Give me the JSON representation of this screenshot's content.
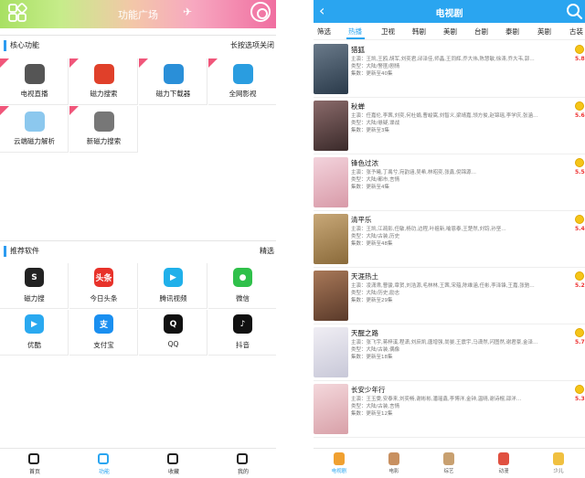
{
  "left": {
    "header_title": "功能广场",
    "core": {
      "label": "核心功能",
      "more": "长按选项关闭",
      "tiles": [
        {
          "name": "电视直播",
          "icon": "tv-icon",
          "color": "#555555"
        },
        {
          "name": "磁力搜索",
          "icon": "magnet-search-icon",
          "color": "#e0402a"
        },
        {
          "name": "磁力下载器",
          "icon": "magnet-download-icon",
          "color": "#2a8fd8"
        },
        {
          "name": "全网影视",
          "icon": "film-icon",
          "color": "#2a9de0"
        },
        {
          "name": "云端磁力解析",
          "icon": "cloud-icon",
          "color": "#8cc8ee"
        },
        {
          "name": "新磁力搜索",
          "icon": "search-magnifier-icon",
          "color": "#777777"
        }
      ]
    },
    "recommend": {
      "label": "推荐软件",
      "more": "精选",
      "apps": [
        {
          "name": "磁力搜",
          "icon": "magnet-s-icon",
          "glyph": "S",
          "color": "#222222"
        },
        {
          "name": "今日头条",
          "icon": "toutiao-icon",
          "glyph": "头条",
          "color": "#e8322a"
        },
        {
          "name": "腾讯视频",
          "icon": "tencent-video-icon",
          "glyph": "▶",
          "color": "#20b0ea"
        },
        {
          "name": "微信",
          "icon": "wechat-icon",
          "glyph": "●",
          "color": "#2fc04a"
        },
        {
          "name": "优酷",
          "icon": "youku-icon",
          "glyph": "▶",
          "color": "#2aa9f0"
        },
        {
          "name": "支付宝",
          "icon": "alipay-icon",
          "glyph": "支",
          "color": "#1a8ff0"
        },
        {
          "name": "QQ",
          "icon": "qq-icon",
          "glyph": "Q",
          "color": "#111111"
        },
        {
          "name": "抖音",
          "icon": "douyin-icon",
          "glyph": "♪",
          "color": "#111111"
        }
      ]
    },
    "nav": [
      {
        "label": "首页",
        "icon": "home-icon"
      },
      {
        "label": "功能",
        "icon": "function-icon",
        "active": true
      },
      {
        "label": "收藏",
        "icon": "favorite-icon"
      },
      {
        "label": "我的",
        "icon": "profile-icon"
      }
    ]
  },
  "right": {
    "header_title": "电视剧",
    "tabs": [
      "筛选",
      "热播",
      "卫视",
      "韩剧",
      "美剧",
      "台剧",
      "泰剧",
      "英剧",
      "古装"
    ],
    "active_tab": 1,
    "dramas": [
      {
        "title": "猎狐",
        "cast": "主演：王凯,王鸥,胡军,刘奕君,邱泽佳,师晶,王同辉,乔大伟,陈慧敏,徐涛,乔大韦,郭…",
        "type": "类型：大陆/警匪/剧情",
        "episodes": "集数：更新至40集",
        "score": "5.8",
        "poster": [
          "#2a3a4a",
          "#6a7a8a"
        ]
      },
      {
        "title": "秋蝉",
        "cast": "主演：任嘉伦,李茜,刘奕,何杜娟,曹峻嵩,刘智义,梁靖嘉,领方俊,赵锦瑶,李学庆,张涵…",
        "type": "类型：大陆/悬疑,谍战",
        "episodes": "集数：更新至3集",
        "score": "5.6",
        "poster": [
          "#3a2a2a",
          "#8a6a6a"
        ]
      },
      {
        "title": "锋色过浓",
        "cast": "主演：张予曦,丁禹兮,宛韵涵,吴希,林昭奕,张鑫,倪锦源…",
        "type": "类型：大陆/都市,言情",
        "episodes": "集数：更新至4集",
        "score": "5.5",
        "poster": [
          "#d89aa8",
          "#f3d3dc"
        ]
      },
      {
        "title": "清平乐",
        "cast": "主演：王凯,江疏影,任敏,杨玏,边程,叶祖新,喻恩泰,王楚然,刘钧,孙坚…",
        "type": "类型：大陆/古装,历史",
        "episodes": "集数：更新至48集",
        "score": "5.4",
        "poster": [
          "#8a6a3a",
          "#c8a878"
        ]
      },
      {
        "title": "天涯热土",
        "cast": "主演：凌潇肃,曹骏,章贺,刘浩源,毛林林,王茜,宋蕴,陈维涵,任彬,李泽锋,王嘉,张驰…",
        "type": "类型：大陆/历史,励志",
        "episodes": "集数：更新至29集",
        "score": "5.2",
        "poster": [
          "#5a3a2a",
          "#a87858"
        ]
      },
      {
        "title": "天醒之路",
        "cast": "主演：张飞宇,蒋梓溪,程潇,刘庶凯,唐增强,尚晏,王震宇,马潇然,闪图然,谢君豪,金泽…",
        "type": "类型：大陆/古装,偶像",
        "episodes": "集数：更新至18集",
        "score": "5.7",
        "poster": [
          "#c8c8d8",
          "#f0eef4"
        ]
      },
      {
        "title": "长安少年行",
        "cast": "主演：王玉雯,安泰来,刘奕畅,谢彬彬,潘瑶鑫,李博洋,金钟,温晴,谢诗棍,邵洋…",
        "type": "类型：大陆/古装,言情",
        "episodes": "集数：更新至12集",
        "score": "5.3",
        "poster": [
          "#d8a0a8",
          "#f4d8dc"
        ]
      }
    ],
    "nav": [
      {
        "label": "电视剧",
        "icon": "tv-drama-icon",
        "color": "#f0a030",
        "active": true
      },
      {
        "label": "电影",
        "icon": "movie-icon",
        "color": "#c89060"
      },
      {
        "label": "综艺",
        "icon": "variety-icon",
        "color": "#c8a070"
      },
      {
        "label": "动漫",
        "icon": "anime-icon",
        "color": "#e05040"
      },
      {
        "label": "少儿",
        "icon": "kids-icon",
        "color": "#f0c040"
      }
    ]
  }
}
